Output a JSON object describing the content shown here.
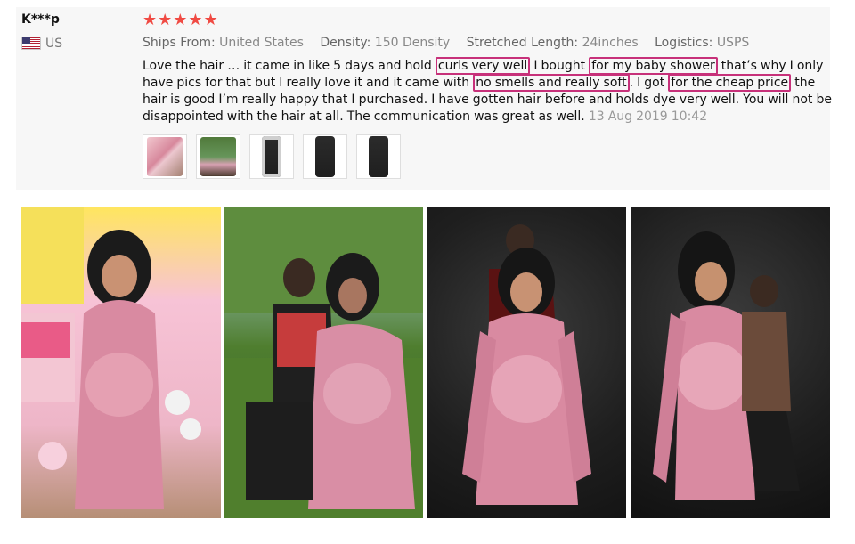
{
  "reviewer": {
    "name": "K***p",
    "country": "US"
  },
  "rating": {
    "stars": "★★★★★"
  },
  "properties": [
    {
      "label": "Ships From:",
      "value": "United States"
    },
    {
      "label": "Density:",
      "value": "150 Density"
    },
    {
      "label": "Stretched Length:",
      "value": "24inches"
    },
    {
      "label": "Logistics:",
      "value": "USPS"
    }
  ],
  "review": {
    "text_segments": [
      "Love the hair … it came in like 5 days and hold",
      "curls very well",
      "I bought",
      "for my baby shower",
      "that’s why I only have pics for that but I really love it and it came with",
      "no smells and really soft",
      ". I got",
      "for the cheap price",
      "the hair is good I’m really happy that I purchased. I have gotten hair before and holds dye very well. You will not be disappointed with the hair at all. The communication was great as well."
    ],
    "date": "13 Aug 2019 10:42"
  },
  "colors": {
    "star": "#f04a43",
    "highlight_border": "#c7317a",
    "review_bg": "#f7f7f7"
  }
}
